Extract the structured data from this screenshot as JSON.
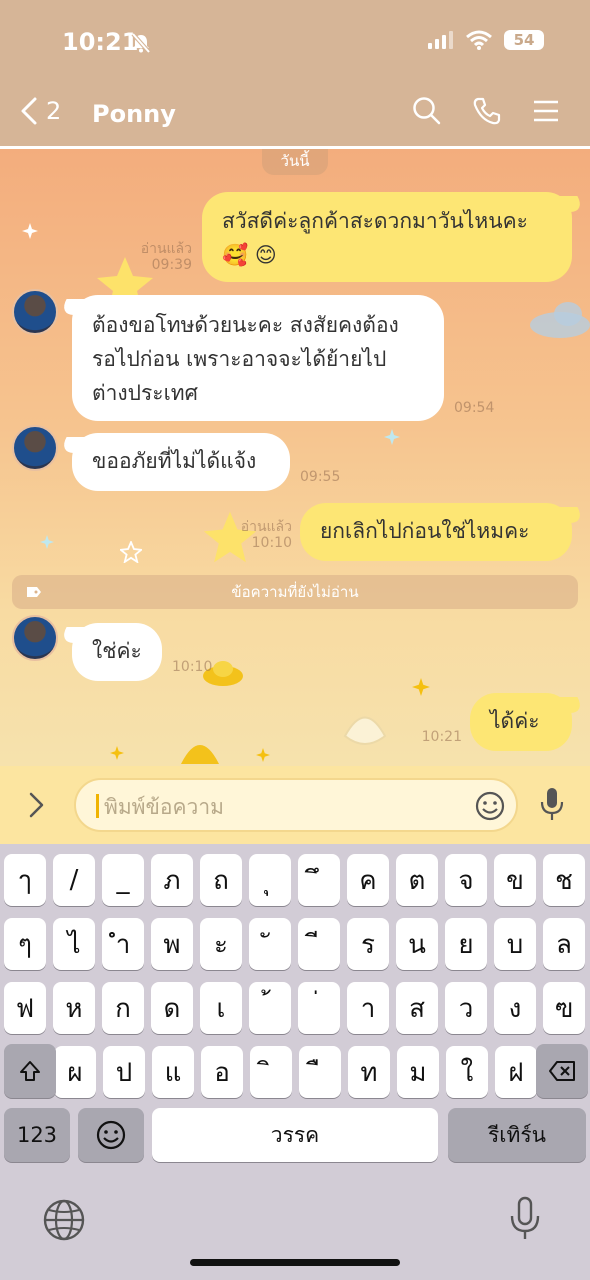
{
  "status_bar": {
    "time": "10:21",
    "battery": "54"
  },
  "header": {
    "back_count": "2",
    "title": "Ponny"
  },
  "chat": {
    "date_label": "วันนี้",
    "unread_divider": "ข้อความที่ยังไม่อ่าน",
    "messages": [
      {
        "side": "out",
        "text_line1": "สวัสดีค่ะลูกค้าสะดวกมาวันไหนคะ",
        "text_line2": "🥰 😊",
        "status": "อ่านแล้ว",
        "time": "09:39"
      },
      {
        "side": "in",
        "text_line1": "ต้องขอโทษด้วยนะคะ สงสัยคงต้อง",
        "text_line2": "รอไปก่อน เพราะอาจจะได้ย้ายไป",
        "text_line3": "ต่างประเทศ",
        "time": "09:54"
      },
      {
        "side": "in",
        "text": "ขออภัยที่ไม่ได้แจ้ง",
        "time": "09:55"
      },
      {
        "side": "out",
        "text": "ยกเลิกไปก่อนใช่ไหมคะ",
        "status": "อ่านแล้ว",
        "time": "10:10"
      },
      {
        "side": "in",
        "text": "ใช่ค่ะ",
        "time": "10:10"
      },
      {
        "side": "out",
        "text": "ได้ค่ะ",
        "time": "10:21"
      }
    ]
  },
  "input": {
    "placeholder": "พิมพ์ข้อความ"
  },
  "keyboard": {
    "row1": [
      "ๅ",
      "/",
      "_",
      "ภ",
      "ถ",
      "ุ",
      "ึ",
      "ค",
      "ต",
      "จ",
      "ข",
      "ช"
    ],
    "row2": [
      "ๆ",
      "ไ",
      "ำ",
      "พ",
      "ะ",
      "ั",
      "ี",
      "ร",
      "น",
      "ย",
      "บ",
      "ล"
    ],
    "row3": [
      "ฟ",
      "ห",
      "ก",
      "ด",
      "เ",
      "้",
      "่",
      "า",
      "ส",
      "ว",
      "ง",
      "ฃ"
    ],
    "row4": [
      "ผ",
      "ป",
      "แ",
      "อ",
      "ิ",
      "ื",
      "ท",
      "ม",
      "ใ",
      "ฝ"
    ],
    "numbers_key": "123",
    "space_key": "วรรค",
    "return_key": "รีเทิร์น"
  },
  "colors": {
    "header": "#d6b597",
    "bubble_out": "#fde674",
    "bubble_in": "#ffffff",
    "input_bar": "#fce5a0"
  },
  "icons": [
    "silent-bell-icon",
    "signal-icon",
    "wifi-icon",
    "battery-icon",
    "back-chevron-icon",
    "search-icon",
    "phone-icon",
    "menu-icon",
    "expand-chevron-icon",
    "emoji-icon",
    "mic-icon",
    "shift-icon",
    "backspace-icon",
    "globe-icon",
    "dictation-icon"
  ]
}
